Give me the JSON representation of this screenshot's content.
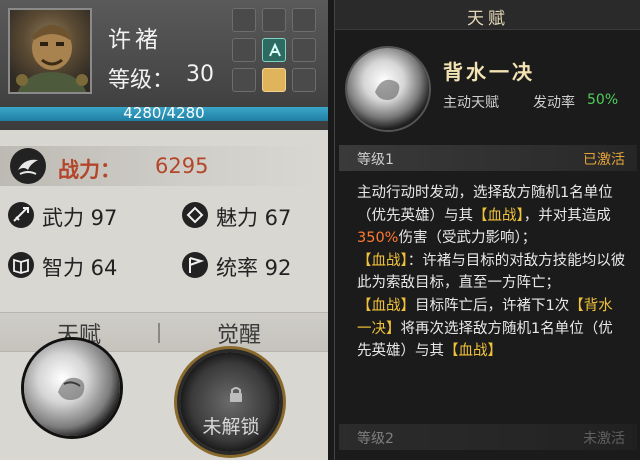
{
  "hero": {
    "name": "许褚",
    "level_label": "等级：",
    "level": "30",
    "hp_text": "4280/4280",
    "hp_fraction": 1.0
  },
  "power": {
    "label": "战力：",
    "value": "6295"
  },
  "stats": {
    "wuli": "武力 97",
    "meili": "魅力 67",
    "zhili": "智力 64",
    "tongshuai": "统率 92"
  },
  "tabs": {
    "talent": "天赋",
    "awaken": "觉醒"
  },
  "awaken_orb": {
    "text": "未解锁"
  },
  "panel": {
    "title": "天赋",
    "skill_name": "背水一决",
    "skill_type": "主动天赋",
    "rate_label": "发动率",
    "rate_value": "50%",
    "level1": {
      "label": "等级1",
      "status": "已激活",
      "status_color": "#e4a43a"
    },
    "level2": {
      "label": "等级2",
      "status": "未激活",
      "status_color": "#9a9a9a"
    },
    "desc": {
      "p1a": "主动行动时发动，选择敌方随机1名单位（优先英雄）与其",
      "kw_bloodwar": "【血战】",
      "p1b": "，并对其造成",
      "dmg": "350%",
      "p1c": "伤害（受武力影响）；",
      "p2": "：许褚与目标的对敌方技能均以彼此为索敌目标，直至一方阵亡；",
      "p3": "目标阵亡后，许褚下1次",
      "kw_skill": "【背水一决】",
      "p3b": "将再次选择敌方随机1名单位（优先英雄）与其"
    }
  },
  "colors": {
    "keyword": "#f0c23a",
    "damage": "#ff7a2e",
    "rate": "#4fce5a",
    "power": "#b3462a"
  }
}
